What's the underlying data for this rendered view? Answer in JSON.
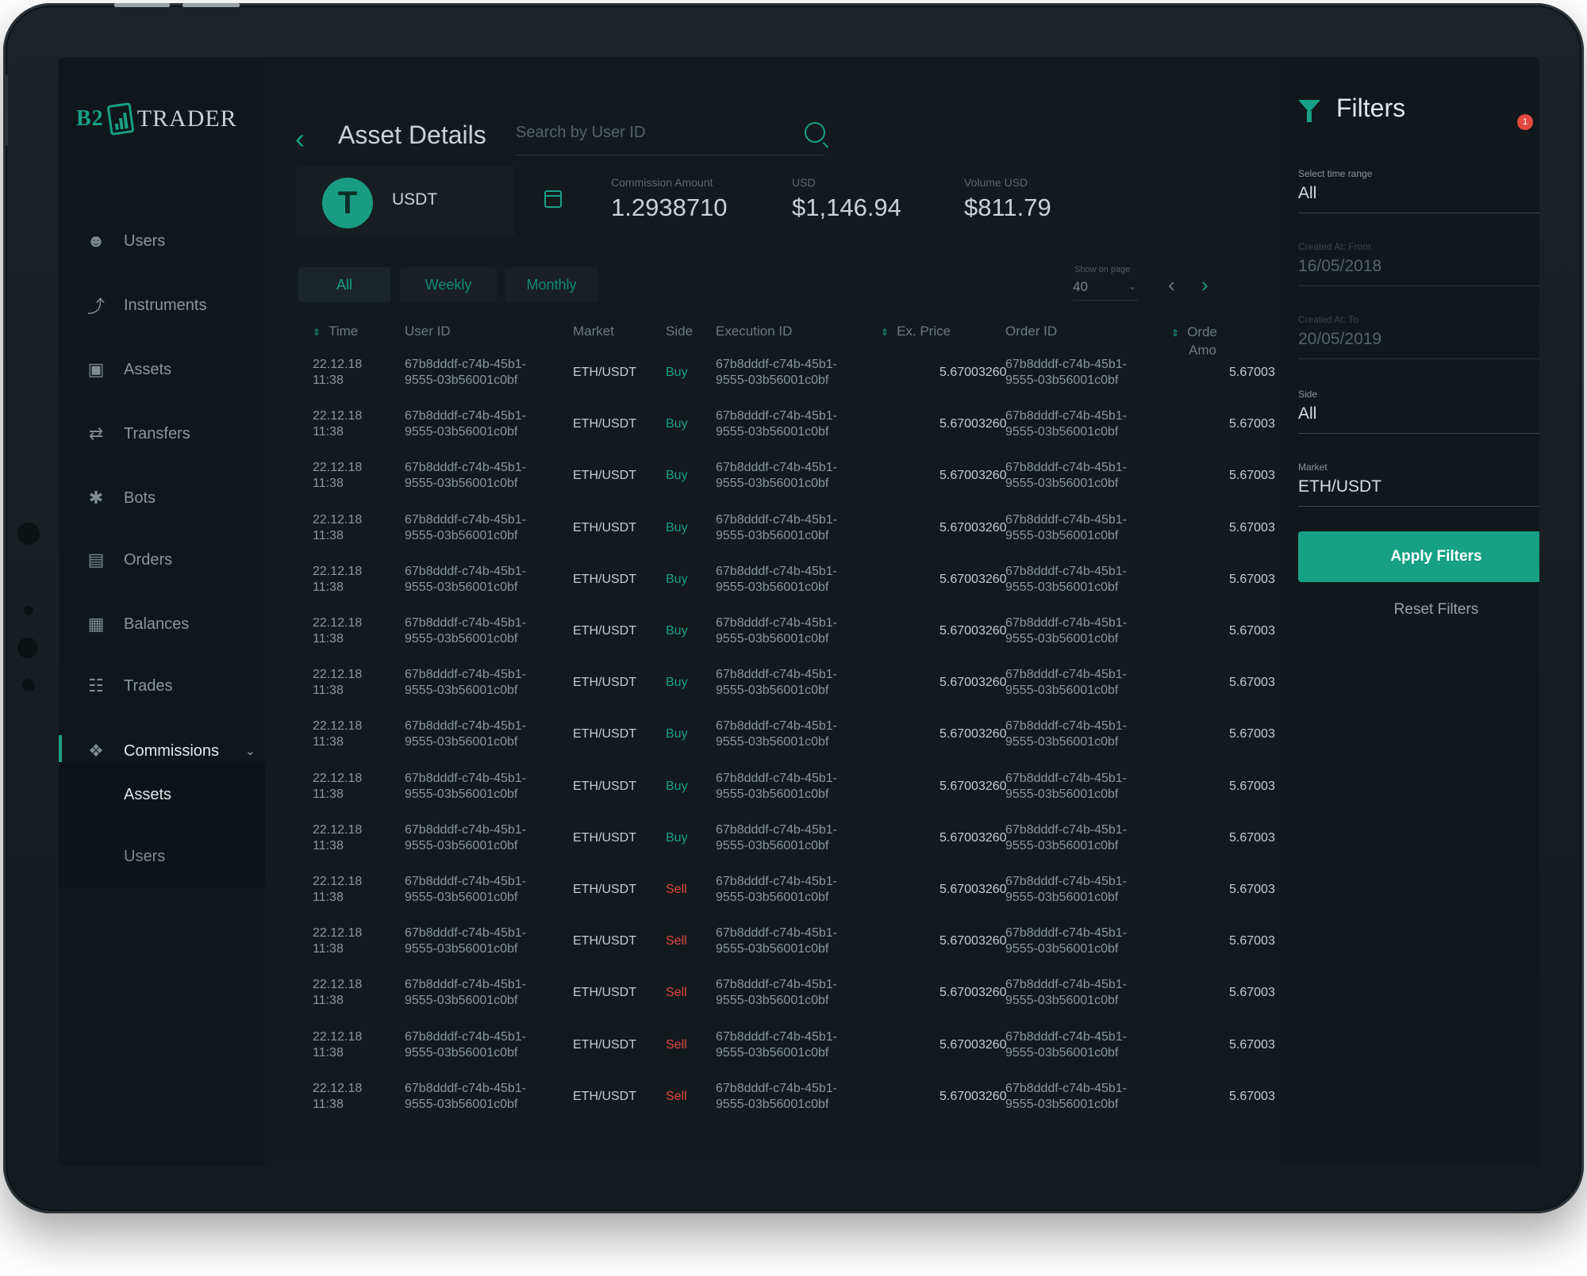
{
  "app": {
    "logo_b2": "B2",
    "logo_trader": "TRADER"
  },
  "sidebar": {
    "items": [
      {
        "label": "Users",
        "icon": "user-icon"
      },
      {
        "label": "Instruments",
        "icon": "chart-line-icon"
      },
      {
        "label": "Assets",
        "icon": "wallet-icon"
      },
      {
        "label": "Transfers",
        "icon": "transfer-arrows-icon"
      },
      {
        "label": "Bots",
        "icon": "bot-icon"
      },
      {
        "label": "Orders",
        "icon": "orders-icon"
      },
      {
        "label": "Balances",
        "icon": "balance-icon"
      },
      {
        "label": "Trades",
        "icon": "trades-icon"
      },
      {
        "label": "Commissions",
        "icon": "tag-icon"
      }
    ],
    "sub_items": [
      {
        "label": "Assets"
      },
      {
        "label": "Users"
      }
    ]
  },
  "header": {
    "title": "Asset Details",
    "search_placeholder": "Search by User ID"
  },
  "asset": {
    "symbol": "USDT",
    "logo_glyph": "T",
    "stats": [
      {
        "label": "Commission Amount",
        "value": "1.2938710"
      },
      {
        "label": "USD",
        "value": "$1,146.94"
      },
      {
        "label": "Volume USD",
        "value": "$811.79"
      }
    ]
  },
  "tabs": [
    {
      "label": "All"
    },
    {
      "label": "Weekly"
    },
    {
      "label": "Monthly"
    }
  ],
  "pager": {
    "label": "Show on page",
    "value": "40"
  },
  "table": {
    "headers": [
      "Time",
      "User ID",
      "Market",
      "Side",
      "Execution ID",
      "Ex. Price",
      "Order ID",
      "Orde",
      "Amo"
    ],
    "rows": [
      {
        "time1": "22.12.18",
        "time2": "11:38",
        "uid1": "67b8dddf-c74b-45b1-",
        "uid2": "9555-03b56001c0bf",
        "market": "ETH/USDT",
        "side": "Buy",
        "exid1": "67b8dddf-c74b-45b1-",
        "exid2": "9555-03b56001c0bf",
        "price": "5.67003260",
        "oid1": "67b8dddf-c74b-45b1-",
        "oid2": "9555-03b56001c0bf",
        "amount": "5.67003"
      },
      {
        "time1": "22.12.18",
        "time2": "11:38",
        "uid1": "67b8dddf-c74b-45b1-",
        "uid2": "9555-03b56001c0bf",
        "market": "ETH/USDT",
        "side": "Buy",
        "exid1": "67b8dddf-c74b-45b1-",
        "exid2": "9555-03b56001c0bf",
        "price": "5.67003260",
        "oid1": "67b8dddf-c74b-45b1-",
        "oid2": "9555-03b56001c0bf",
        "amount": "5.67003"
      },
      {
        "time1": "22.12.18",
        "time2": "11:38",
        "uid1": "67b8dddf-c74b-45b1-",
        "uid2": "9555-03b56001c0bf",
        "market": "ETH/USDT",
        "side": "Buy",
        "exid1": "67b8dddf-c74b-45b1-",
        "exid2": "9555-03b56001c0bf",
        "price": "5.67003260",
        "oid1": "67b8dddf-c74b-45b1-",
        "oid2": "9555-03b56001c0bf",
        "amount": "5.67003"
      },
      {
        "time1": "22.12.18",
        "time2": "11:38",
        "uid1": "67b8dddf-c74b-45b1-",
        "uid2": "9555-03b56001c0bf",
        "market": "ETH/USDT",
        "side": "Buy",
        "exid1": "67b8dddf-c74b-45b1-",
        "exid2": "9555-03b56001c0bf",
        "price": "5.67003260",
        "oid1": "67b8dddf-c74b-45b1-",
        "oid2": "9555-03b56001c0bf",
        "amount": "5.67003"
      },
      {
        "time1": "22.12.18",
        "time2": "11:38",
        "uid1": "67b8dddf-c74b-45b1-",
        "uid2": "9555-03b56001c0bf",
        "market": "ETH/USDT",
        "side": "Buy",
        "exid1": "67b8dddf-c74b-45b1-",
        "exid2": "9555-03b56001c0bf",
        "price": "5.67003260",
        "oid1": "67b8dddf-c74b-45b1-",
        "oid2": "9555-03b56001c0bf",
        "amount": "5.67003"
      },
      {
        "time1": "22.12.18",
        "time2": "11:38",
        "uid1": "67b8dddf-c74b-45b1-",
        "uid2": "9555-03b56001c0bf",
        "market": "ETH/USDT",
        "side": "Buy",
        "exid1": "67b8dddf-c74b-45b1-",
        "exid2": "9555-03b56001c0bf",
        "price": "5.67003260",
        "oid1": "67b8dddf-c74b-45b1-",
        "oid2": "9555-03b56001c0bf",
        "amount": "5.67003"
      },
      {
        "time1": "22.12.18",
        "time2": "11:38",
        "uid1": "67b8dddf-c74b-45b1-",
        "uid2": "9555-03b56001c0bf",
        "market": "ETH/USDT",
        "side": "Buy",
        "exid1": "67b8dddf-c74b-45b1-",
        "exid2": "9555-03b56001c0bf",
        "price": "5.67003260",
        "oid1": "67b8dddf-c74b-45b1-",
        "oid2": "9555-03b56001c0bf",
        "amount": "5.67003"
      },
      {
        "time1": "22.12.18",
        "time2": "11:38",
        "uid1": "67b8dddf-c74b-45b1-",
        "uid2": "9555-03b56001c0bf",
        "market": "ETH/USDT",
        "side": "Buy",
        "exid1": "67b8dddf-c74b-45b1-",
        "exid2": "9555-03b56001c0bf",
        "price": "5.67003260",
        "oid1": "67b8dddf-c74b-45b1-",
        "oid2": "9555-03b56001c0bf",
        "amount": "5.67003"
      },
      {
        "time1": "22.12.18",
        "time2": "11:38",
        "uid1": "67b8dddf-c74b-45b1-",
        "uid2": "9555-03b56001c0bf",
        "market": "ETH/USDT",
        "side": "Buy",
        "exid1": "67b8dddf-c74b-45b1-",
        "exid2": "9555-03b56001c0bf",
        "price": "5.67003260",
        "oid1": "67b8dddf-c74b-45b1-",
        "oid2": "9555-03b56001c0bf",
        "amount": "5.67003"
      },
      {
        "time1": "22.12.18",
        "time2": "11:38",
        "uid1": "67b8dddf-c74b-45b1-",
        "uid2": "9555-03b56001c0bf",
        "market": "ETH/USDT",
        "side": "Buy",
        "exid1": "67b8dddf-c74b-45b1-",
        "exid2": "9555-03b56001c0bf",
        "price": "5.67003260",
        "oid1": "67b8dddf-c74b-45b1-",
        "oid2": "9555-03b56001c0bf",
        "amount": "5.67003"
      },
      {
        "time1": "22.12.18",
        "time2": "11:38",
        "uid1": "67b8dddf-c74b-45b1-",
        "uid2": "9555-03b56001c0bf",
        "market": "ETH/USDT",
        "side": "Sell",
        "exid1": "67b8dddf-c74b-45b1-",
        "exid2": "9555-03b56001c0bf",
        "price": "5.67003260",
        "oid1": "67b8dddf-c74b-45b1-",
        "oid2": "9555-03b56001c0bf",
        "amount": "5.67003"
      },
      {
        "time1": "22.12.18",
        "time2": "11:38",
        "uid1": "67b8dddf-c74b-45b1-",
        "uid2": "9555-03b56001c0bf",
        "market": "ETH/USDT",
        "side": "Sell",
        "exid1": "67b8dddf-c74b-45b1-",
        "exid2": "9555-03b56001c0bf",
        "price": "5.67003260",
        "oid1": "67b8dddf-c74b-45b1-",
        "oid2": "9555-03b56001c0bf",
        "amount": "5.67003"
      },
      {
        "time1": "22.12.18",
        "time2": "11:38",
        "uid1": "67b8dddf-c74b-45b1-",
        "uid2": "9555-03b56001c0bf",
        "market": "ETH/USDT",
        "side": "Sell",
        "exid1": "67b8dddf-c74b-45b1-",
        "exid2": "9555-03b56001c0bf",
        "price": "5.67003260",
        "oid1": "67b8dddf-c74b-45b1-",
        "oid2": "9555-03b56001c0bf",
        "amount": "5.67003"
      },
      {
        "time1": "22.12.18",
        "time2": "11:38",
        "uid1": "67b8dddf-c74b-45b1-",
        "uid2": "9555-03b56001c0bf",
        "market": "ETH/USDT",
        "side": "Sell",
        "exid1": "67b8dddf-c74b-45b1-",
        "exid2": "9555-03b56001c0bf",
        "price": "5.67003260",
        "oid1": "67b8dddf-c74b-45b1-",
        "oid2": "9555-03b56001c0bf",
        "amount": "5.67003"
      },
      {
        "time1": "22.12.18",
        "time2": "11:38",
        "uid1": "67b8dddf-c74b-45b1-",
        "uid2": "9555-03b56001c0bf",
        "market": "ETH/USDT",
        "side": "Sell",
        "exid1": "67b8dddf-c74b-45b1-",
        "exid2": "9555-03b56001c0bf",
        "price": "5.67003260",
        "oid1": "67b8dddf-c74b-45b1-",
        "oid2": "9555-03b56001c0bf",
        "amount": "5.67003"
      }
    ]
  },
  "filters": {
    "title": "Filters",
    "badge_count": "1",
    "time_range": {
      "label": "Select time range",
      "value": "All"
    },
    "created_from": {
      "label": "Created At: From",
      "value": "16/05/2018"
    },
    "created_to": {
      "label": "Created At: To",
      "value": "20/05/2019"
    },
    "side": {
      "label": "Side",
      "value": "All"
    },
    "market": {
      "label": "Market",
      "value": "ETH/USDT"
    },
    "apply_label": "Apply Filters",
    "reset_label": "Reset Filters"
  },
  "colors": {
    "accent": "#16a085",
    "buy": "#16a085",
    "sell": "#e0463c",
    "background": "#131a1e",
    "badge": "#e24a3f"
  }
}
